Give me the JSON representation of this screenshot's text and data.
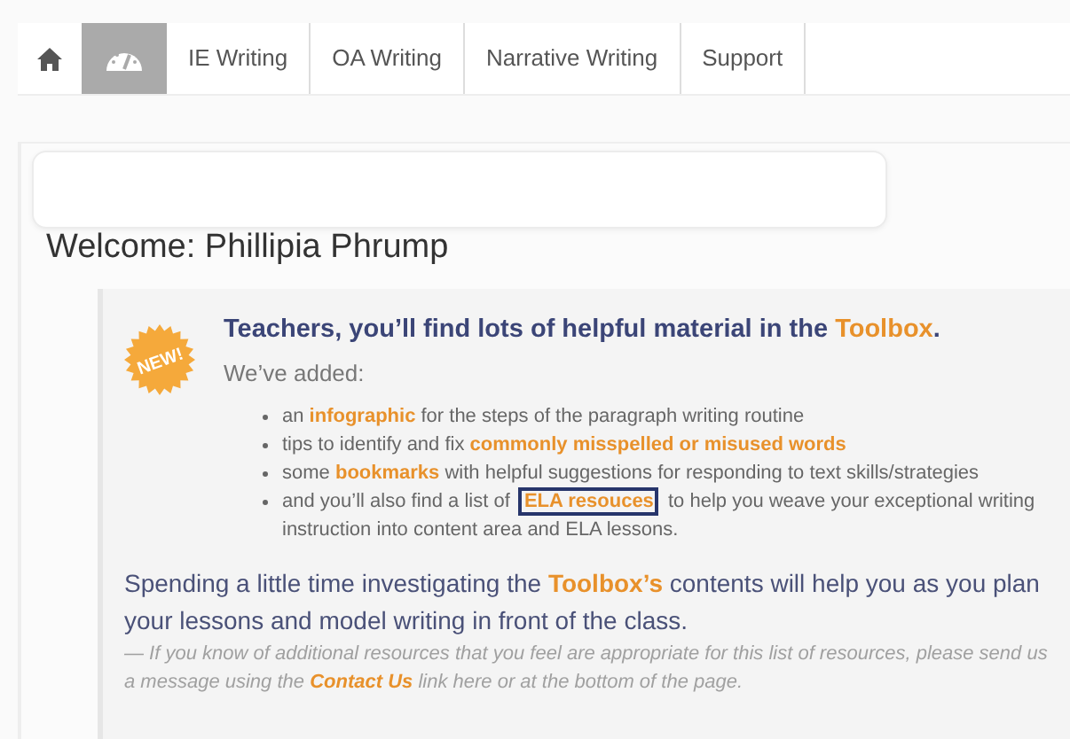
{
  "nav": {
    "items": [
      {
        "kind": "home",
        "selected": false
      },
      {
        "kind": "dashboard",
        "selected": true
      },
      {
        "kind": "text",
        "label": "IE Writing",
        "selected": false
      },
      {
        "kind": "text",
        "label": "OA Writing",
        "selected": false
      },
      {
        "kind": "text",
        "label": "Narrative Writing",
        "selected": false
      },
      {
        "kind": "text",
        "label": "Support",
        "selected": false
      }
    ]
  },
  "welcome": "Welcome: Phillipia Phrump",
  "callout": {
    "badge": "NEW!",
    "heading": [
      {
        "kind": "text",
        "text": "Teachers, you’ll find lots of helpful material in the "
      },
      {
        "kind": "link",
        "text": "Toolbox"
      },
      {
        "kind": "text",
        "text": "."
      }
    ],
    "intro": "We’ve added:",
    "bullets": [
      [
        {
          "kind": "text",
          "text": "an "
        },
        {
          "kind": "link",
          "text": "infographic"
        },
        {
          "kind": "text",
          "text": " for the steps of the paragraph writing routine"
        }
      ],
      [
        {
          "kind": "text",
          "text": "tips to identify and fix "
        },
        {
          "kind": "link",
          "text": "commonly misspelled or misused words"
        }
      ],
      [
        {
          "kind": "text",
          "text": "some "
        },
        {
          "kind": "link",
          "text": "bookmarks"
        },
        {
          "kind": "text",
          "text": " with helpful suggestions for responding to text skills/strategies"
        }
      ],
      [
        {
          "kind": "text",
          "text": "and you’ll also find a list of "
        },
        {
          "kind": "link",
          "text": "ELA resouces",
          "highlighted": true
        },
        {
          "kind": "text",
          "text": " to help you weave your exceptional writing instruction into content area and ELA lessons."
        }
      ]
    ],
    "summary": [
      {
        "kind": "text",
        "text": "Spending a little time investigating the "
      },
      {
        "kind": "link",
        "text": "Toolbox’s"
      },
      {
        "kind": "text",
        "text": " contents will help you as you plan your lessons and model writing in front of the class."
      }
    ],
    "note": [
      {
        "kind": "text",
        "text": "— If you know of additional resources that you feel are appropriate for this list of resources, please send us a message using the "
      },
      {
        "kind": "link",
        "text": "Contact Us"
      },
      {
        "kind": "text",
        "text": " link here or at the bottom of the page."
      }
    ]
  }
}
